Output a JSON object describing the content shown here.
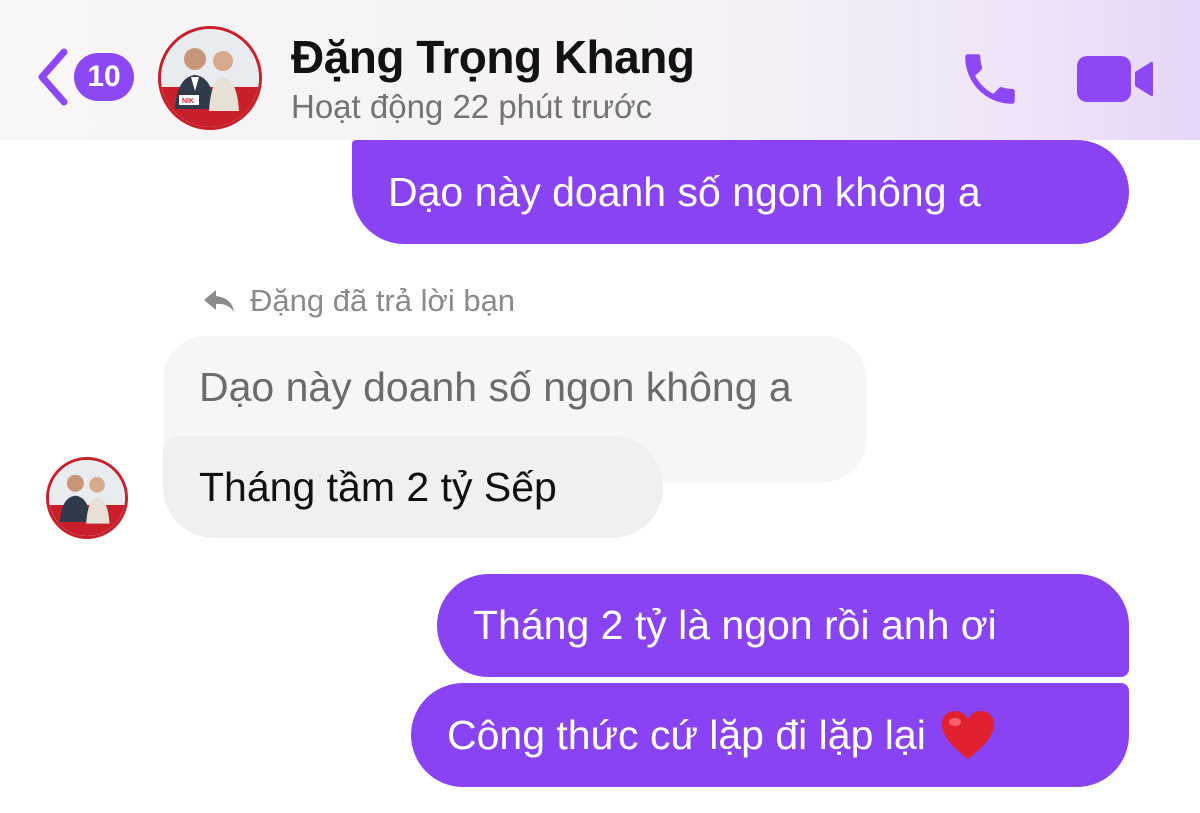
{
  "header": {
    "back_badge": "10",
    "contact_name": "Đặng Trọng Khang",
    "status": "Hoạt động 22 phút trước",
    "accent_color": "#8a43f3"
  },
  "messages": [
    {
      "direction": "outgoing",
      "text": "Dạo này doanh số ngon không a"
    },
    {
      "direction": "reply-label",
      "text": "Đặng đã trả lời bạn"
    },
    {
      "direction": "quoted",
      "text": "Dạo này doanh số ngon không a"
    },
    {
      "direction": "incoming",
      "text": "Tháng tầm 2 tỷ Sếp"
    },
    {
      "direction": "outgoing",
      "text": "Tháng 2 tỷ là ngon rồi anh ơi"
    },
    {
      "direction": "outgoing",
      "text": "Công thức cứ lặp đi lặp lại",
      "emoji": "heart"
    }
  ],
  "avatar": {
    "badge_text": "NIK"
  },
  "icons": [
    "back-chevron-icon",
    "phone-icon",
    "video-camera-icon",
    "reply-arrow-icon",
    "heart-emoji-icon"
  ]
}
